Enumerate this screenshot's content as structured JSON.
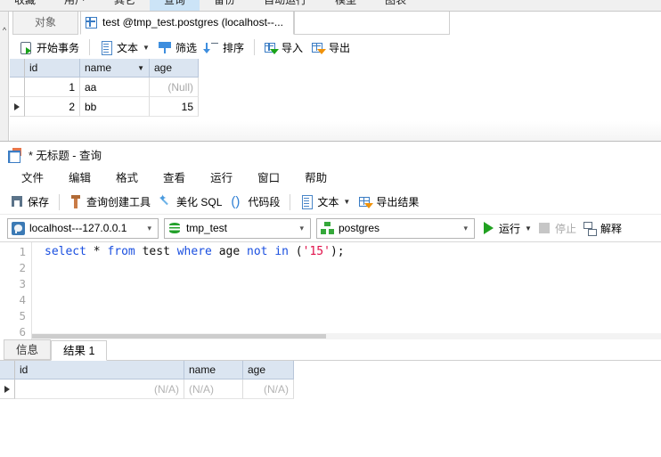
{
  "ribbon": {
    "tabs": [
      {
        "label": "收藏",
        "active": false
      },
      {
        "label": "用户",
        "active": false
      },
      {
        "label": "其它",
        "active": false
      },
      {
        "label": "查询",
        "active": true
      },
      {
        "label": "备份",
        "active": false
      },
      {
        "label": "自动运行",
        "active": false
      },
      {
        "label": "模型",
        "active": false
      },
      {
        "label": "图表",
        "active": false
      }
    ]
  },
  "main_window": {
    "tabs": {
      "object_tab": "对象",
      "active_tab": "test @tmp_test.postgres (localhost--..."
    },
    "toolbar": {
      "begin_transaction": "开始事务",
      "text": "文本",
      "filter": "筛选",
      "sort": "排序",
      "import": "导入",
      "export": "导出"
    },
    "grid": {
      "columns": [
        "id",
        "name",
        "age"
      ],
      "sorted_column": "name",
      "rows": [
        {
          "id": "1",
          "name": "aa",
          "age": "(Null)",
          "age_is_null": true,
          "selected": false
        },
        {
          "id": "2",
          "name": "bb",
          "age": "15",
          "age_is_null": false,
          "selected": true
        }
      ]
    }
  },
  "query_window": {
    "title": "* 无标题 - 查询",
    "menu": [
      "文件",
      "编辑",
      "格式",
      "查看",
      "运行",
      "窗口",
      "帮助"
    ],
    "toolbar": {
      "save": "保存",
      "query_builder": "查询创建工具",
      "beautify_sql": "美化 SQL",
      "snippet": "代码段",
      "text": "文本",
      "export_result": "导出结果"
    },
    "connection_bar": {
      "connection": "localhost---127.0.0.1",
      "database": "tmp_test",
      "schema": "postgres",
      "run": "运行",
      "stop": "停止",
      "explain": "解释"
    },
    "editor": {
      "line_numbers": [
        "1",
        "2",
        "3",
        "4",
        "5",
        "6"
      ],
      "sql_tokens": [
        {
          "t": "select",
          "k": "kw"
        },
        {
          "t": " * ",
          "k": "plain"
        },
        {
          "t": "from",
          "k": "kw"
        },
        {
          "t": " test ",
          "k": "plain"
        },
        {
          "t": "where",
          "k": "kw"
        },
        {
          "t": " age ",
          "k": "plain"
        },
        {
          "t": "not",
          "k": "kw"
        },
        {
          "t": " ",
          "k": "plain"
        },
        {
          "t": "in",
          "k": "kw"
        },
        {
          "t": " (",
          "k": "plain"
        },
        {
          "t": "'15'",
          "k": "str"
        },
        {
          "t": ");",
          "k": "plain"
        }
      ],
      "sql_text": "select * from test where age not in ('15');"
    },
    "result_tabs": [
      {
        "label": "信息",
        "active": false
      },
      {
        "label": "结果 1",
        "active": true
      }
    ],
    "result_grid": {
      "columns": [
        "id",
        "name",
        "age"
      ],
      "rows": [
        {
          "id": "(N/A)",
          "name": "(N/A)",
          "age": "(N/A)",
          "selected": true
        }
      ]
    }
  },
  "colors": {
    "ribbon_active": "#cce4f7",
    "grid_header": "#dbe5f1",
    "sql_keyword": "#1a4fe0",
    "sql_string": "#e0114a",
    "run_green": "#21a121"
  }
}
